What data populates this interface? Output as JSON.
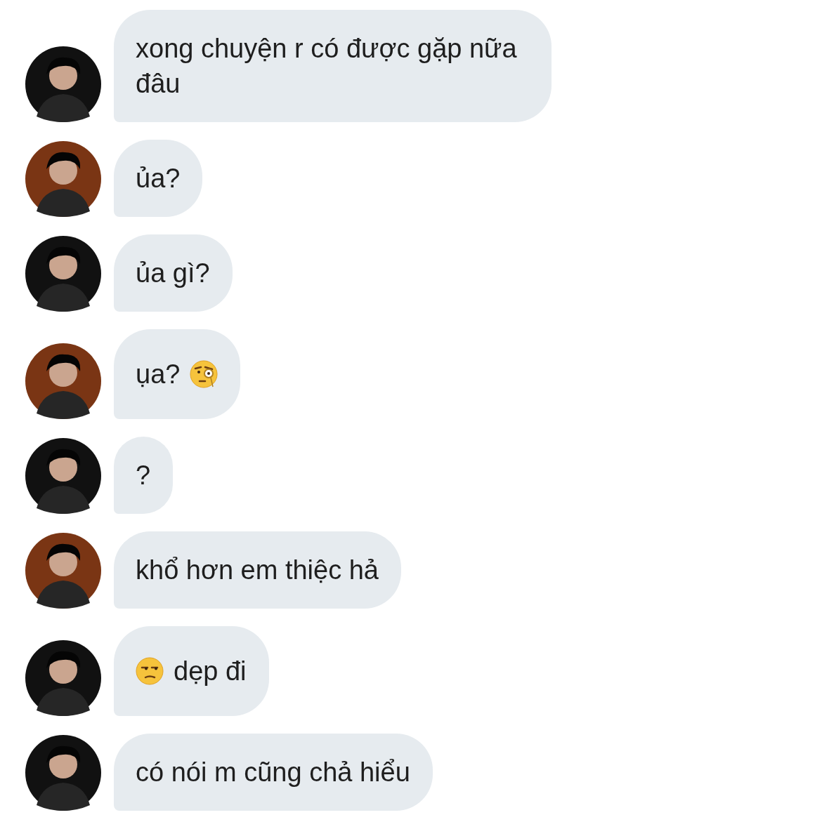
{
  "messages": [
    {
      "kind": "text",
      "color": "#111111",
      "text": "xong chuyện r có được gặp nữa đâu"
    },
    {
      "kind": "text",
      "color": "#7a3514",
      "text": "ủa?"
    },
    {
      "kind": "text",
      "color": "#111111",
      "text": "ủa gì?"
    },
    {
      "kind": "emoji_after",
      "color": "#7a3514",
      "text": "ụa?"
    },
    {
      "kind": "text",
      "color": "#111111",
      "text": "?"
    },
    {
      "kind": "text",
      "color": "#7a3514",
      "text": "khổ hơn em thiệc hả"
    },
    {
      "kind": "emoji_before",
      "color": "#111111",
      "text": "dẹp đi"
    },
    {
      "kind": "text",
      "color": "#111111",
      "text": "có nói m cũng chả hiểu"
    }
  ]
}
